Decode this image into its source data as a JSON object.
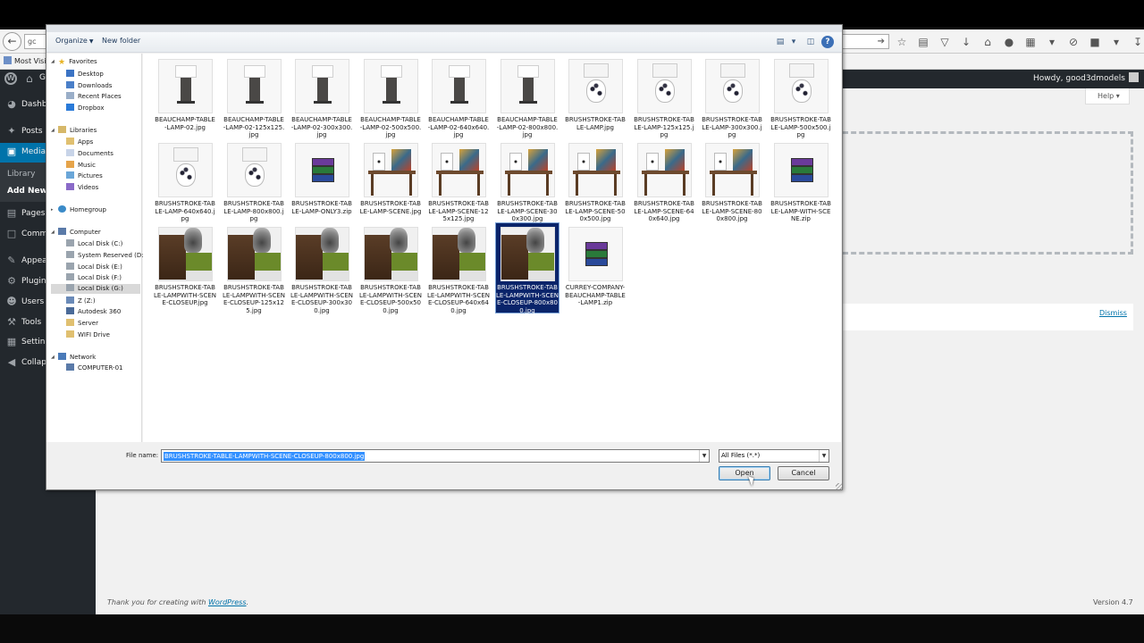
{
  "browser": {
    "url_left": "gc",
    "bookmark": "Most Visite",
    "nav_url_caret": "➔"
  },
  "wp_admin": {
    "site_title": "G",
    "howdy": "Howdy, good3dmodels",
    "help_label": "Help",
    "dismiss_label": "Dismiss",
    "footer_thanks_prefix": "Thank you for creating with ",
    "footer_thanks_link": "WordPress",
    "footer_thanks_suffix": ".",
    "version": "Version 4.7",
    "sidebar": {
      "dashboard": "Dashb",
      "posts": "Posts",
      "media": "Media",
      "library": "Library",
      "add_new": "Add New",
      "pages": "Pages",
      "comments": "Comm",
      "appearance": "Appea",
      "plugins": "Plugins",
      "users": "Users",
      "tools": "Tools",
      "settings": "Setting",
      "collapse": "Collaps"
    }
  },
  "dialog": {
    "toolbar": {
      "organize": "Organize",
      "new_folder": "New folder"
    },
    "nav": {
      "favorites": "Favorites",
      "desktop": "Desktop",
      "downloads": "Downloads",
      "recent_places": "Recent Places",
      "dropbox": "Dropbox",
      "libraries": "Libraries",
      "apps": "Apps",
      "documents": "Documents",
      "music": "Music",
      "pictures": "Pictures",
      "videos": "Videos",
      "homegroup": "Homegroup",
      "computer": "Computer",
      "disk_c": "Local Disk (C:)",
      "system_reserved": "System Reserved (D:)",
      "disk_e": "Local Disk (E:)",
      "disk_f": "Local Disk (F:)",
      "disk_g": "Local Disk (G:)",
      "z_drive": "Z (Z:)",
      "autodesk": "Autodesk 360",
      "server": "Server",
      "wifi": "WIFI Drive",
      "network": "Network",
      "computer01": "COMPUTER-01"
    },
    "files": [
      {
        "name": "BEAUCHAMP-TABLE-LAMP-02.jpg"
      },
      {
        "name": "BEAUCHAMP-TABLE-LAMP-02-125x125.jpg"
      },
      {
        "name": "BEAUCHAMP-TABLE-LAMP-02-300x300.jpg"
      },
      {
        "name": "BEAUCHAMP-TABLE-LAMP-02-500x500.jpg"
      },
      {
        "name": "BEAUCHAMP-TABLE-LAMP-02-640x640.jpg"
      },
      {
        "name": "BEAUCHAMP-TABLE-LAMP-02-800x800.jpg"
      },
      {
        "name": "BRUSHSTROKE-TABLE-LAMP.jpg"
      },
      {
        "name": "BRUSHSTROKE-TABLE-LAMP-125x125.jpg"
      },
      {
        "name": "BRUSHSTROKE-TABLE-LAMP-300x300.jpg"
      },
      {
        "name": "BRUSHSTROKE-TABLE-LAMP-500x500.jpg"
      },
      {
        "name": "BRUSHSTROKE-TABLE-LAMP-640x640.jpg"
      },
      {
        "name": "BRUSHSTROKE-TABLE-LAMP-800x800.jpg"
      },
      {
        "name": "BRUSHSTROKE-TABLE-LAMP-ONLY3.zip"
      },
      {
        "name": "BRUSHSTROKE-TABLE-LAMP-SCENE.jpg"
      },
      {
        "name": "BRUSHSTROKE-TABLE-LAMP-SCENE-125x125.jpg"
      },
      {
        "name": "BRUSHSTROKE-TABLE-LAMP-SCENE-300x300.jpg"
      },
      {
        "name": "BRUSHSTROKE-TABLE-LAMP-SCENE-500x500.jpg"
      },
      {
        "name": "BRUSHSTROKE-TABLE-LAMP-SCENE-640x640.jpg"
      },
      {
        "name": "BRUSHSTROKE-TABLE-LAMP-SCENE-800x800.jpg"
      },
      {
        "name": "BRUSHSTROKE-TABLE-LAMP-WITH-SCENE.zip"
      },
      {
        "name": "BRUSHSTROKE-TABLE-LAMPWITH-SCENE-CLOSEUP.jpg"
      },
      {
        "name": "BRUSHSTROKE-TABLE-LAMPWITH-SCENE-CLOSEUP-125x125.jpg"
      },
      {
        "name": "BRUSHSTROKE-TABLE-LAMPWITH-SCENE-CLOSEUP-300x300.jpg"
      },
      {
        "name": "BRUSHSTROKE-TABLE-LAMPWITH-SCENE-CLOSEUP-500x500.jpg"
      },
      {
        "name": "BRUSHSTROKE-TABLE-LAMPWITH-SCENE-CLOSEUP-640x640.jpg"
      },
      {
        "name": "BRUSHSTROKE-TABLE-LAMPWITH-SCENE-CLOSEUP-800x800.jpg"
      },
      {
        "name": "CURREY-COMPANY-BEAUCHAMP-TABLE-LAMP1.zip"
      }
    ],
    "file_name_label": "File name:",
    "file_name_value": "BRUSHSTROKE-TABLE-LAMPWITH-SCENE-CLOSEUP-800x800.jpg",
    "file_type": "All Files (*.*)",
    "open_label": "Open",
    "cancel_label": "Cancel",
    "selected_color": "#0a246a"
  }
}
